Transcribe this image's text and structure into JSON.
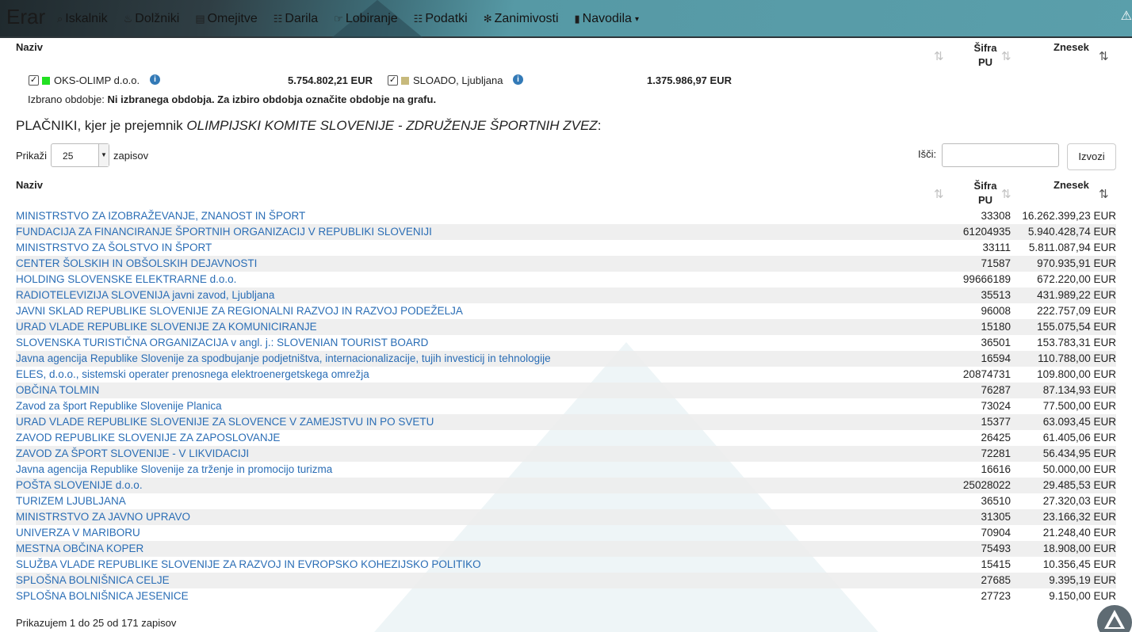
{
  "navbar": {
    "brand": "Erar",
    "items": [
      {
        "label": "Iskalnik",
        "icon": "search-icon",
        "glyph": "⌕"
      },
      {
        "label": "Dolžniki",
        "icon": "fire-icon",
        "glyph": "♨"
      },
      {
        "label": "Omejitve",
        "icon": "briefcase-icon",
        "glyph": "▤"
      },
      {
        "label": "Darila",
        "icon": "gift-icon",
        "glyph": "☷"
      },
      {
        "label": "Lobiranje",
        "icon": "hand-icon",
        "glyph": "☞"
      },
      {
        "label": "Podatki",
        "icon": "grid-icon",
        "glyph": "☷"
      },
      {
        "label": "Zanimivosti",
        "icon": "asterisk-icon",
        "glyph": "✻"
      },
      {
        "label": "Navodila",
        "icon": "book-icon",
        "glyph": "▮",
        "dropdown": true
      }
    ]
  },
  "top_table": {
    "col_naziv": "Naziv",
    "col_sifra_line1": "Šifra",
    "col_sifra_line2": "PU",
    "col_znesek": "Znesek"
  },
  "selected": {
    "a_label": "OKS-OLIMP d.o.o.",
    "a_color": "#22e022",
    "a_amount": "5.754.802,21 EUR",
    "b_label": "SLOADO, Ljubljana",
    "b_color": "#c7b97c",
    "b_amount": "1.375.986,97 EUR"
  },
  "period": {
    "label": "Izbrano obdobje:",
    "value": "Ni izbranega obdobja. Za izbiro obdobja označite obdobje na grafu."
  },
  "section": {
    "prefix": "PLAČNIKI, kjer je prejemnik",
    "recipient": "OLIMPIJSKI KOMITE SLOVENIJE - ZDRUŽENJE ŠPORTNIH ZVEZ",
    "suffix": ":"
  },
  "controls": {
    "show_label": "Prikaži",
    "page_size": "25",
    "records_label": "zapisov",
    "search_label": "Išči:",
    "search_value": "",
    "export_label": "Izvozi"
  },
  "table": {
    "col_naziv": "Naziv",
    "col_sifra_line1": "Šifra",
    "col_sifra_line2": "PU",
    "col_znesek": "Znesek",
    "rows": [
      {
        "name": "MINISTRSTVO ZA IZOBRAŽEVANJE, ZNANOST IN ŠPORT",
        "code": "33308",
        "amount": "16.262.399,23 EUR"
      },
      {
        "name": "FUNDACIJA ZA FINANCIRANJE ŠPORTNIH ORGANIZACIJ V REPUBLIKI SLOVENIJI",
        "code": "61204935",
        "amount": "5.940.428,74 EUR"
      },
      {
        "name": "MINISTRSTVO ZA ŠOLSTVO IN ŠPORT",
        "code": "33111",
        "amount": "5.811.087,94 EUR"
      },
      {
        "name": "CENTER ŠOLSKIH IN OBŠOLSKIH DEJAVNOSTI",
        "code": "71587",
        "amount": "970.935,91 EUR"
      },
      {
        "name": "HOLDING SLOVENSKE ELEKTRARNE d.o.o.",
        "code": "99666189",
        "amount": "672.220,00 EUR"
      },
      {
        "name": "RADIOTELEVIZIJA SLOVENIJA javni zavod, Ljubljana",
        "code": "35513",
        "amount": "431.989,22 EUR"
      },
      {
        "name": "JAVNI SKLAD REPUBLIKE SLOVENIJE ZA REGIONALNI RAZVOJ IN RAZVOJ PODEŽELJA",
        "code": "96008",
        "amount": "222.757,09 EUR"
      },
      {
        "name": "URAD VLADE REPUBLIKE SLOVENIJE ZA KOMUNICIRANJE",
        "code": "15180",
        "amount": "155.075,54 EUR"
      },
      {
        "name": "SLOVENSKA TURISTIČNA ORGANIZACIJA v angl. j.: SLOVENIAN TOURIST BOARD",
        "code": "36501",
        "amount": "153.783,31 EUR"
      },
      {
        "name": "Javna agencija Republike Slovenije za spodbujanje podjetništva, internacionalizacije, tujih investicij in tehnologije",
        "code": "16594",
        "amount": "110.788,00 EUR"
      },
      {
        "name": "ELES, d.o.o., sistemski operater prenosnega elektroenergetskega omrežja",
        "code": "20874731",
        "amount": "109.800,00 EUR"
      },
      {
        "name": "OBČINA TOLMIN",
        "code": "76287",
        "amount": "87.134,93 EUR"
      },
      {
        "name": "Zavod za šport Republike Slovenije Planica",
        "code": "73024",
        "amount": "77.500,00 EUR"
      },
      {
        "name": "URAD VLADE REPUBLIKE SLOVENIJE ZA SLOVENCE V ZAMEJSTVU IN PO SVETU",
        "code": "15377",
        "amount": "63.093,45 EUR"
      },
      {
        "name": "ZAVOD REPUBLIKE SLOVENIJE ZA ZAPOSLOVANJE",
        "code": "26425",
        "amount": "61.405,06 EUR"
      },
      {
        "name": "ZAVOD ZA ŠPORT SLOVENIJE - V LIKVIDACIJI",
        "code": "72281",
        "amount": "56.434,95 EUR"
      },
      {
        "name": "Javna agencija Republike Slovenije za trženje in promocijo turizma",
        "code": "16616",
        "amount": "50.000,00 EUR"
      },
      {
        "name": "POŠTA SLOVENIJE d.o.o.",
        "code": "25028022",
        "amount": "29.485,53 EUR"
      },
      {
        "name": "TURIZEM LJUBLJANA",
        "code": "36510",
        "amount": "27.320,03 EUR"
      },
      {
        "name": "MINISTRSTVO ZA JAVNO UPRAVO",
        "code": "31305",
        "amount": "23.166,32 EUR"
      },
      {
        "name": "UNIVERZA V MARIBORU",
        "code": "70904",
        "amount": "21.248,40 EUR"
      },
      {
        "name": "MESTNA OBČINA KOPER",
        "code": "75493",
        "amount": "18.908,00 EUR"
      },
      {
        "name": "SLUŽBA VLADE REPUBLIKE SLOVENIJE ZA RAZVOJ IN EVROPSKO KOHEZIJSKO POLITIKO",
        "code": "15415",
        "amount": "10.356,45 EUR"
      },
      {
        "name": "SPLOŠNA BOLNIŠNICA CELJE",
        "code": "27685",
        "amount": "9.395,19 EUR"
      },
      {
        "name": "SPLOŠNA BOLNIŠNICA JESENICE",
        "code": "27723",
        "amount": "9.150,00 EUR"
      }
    ]
  },
  "footer": {
    "info": "Prikazujem 1 do 25 od 171 zapisov"
  }
}
